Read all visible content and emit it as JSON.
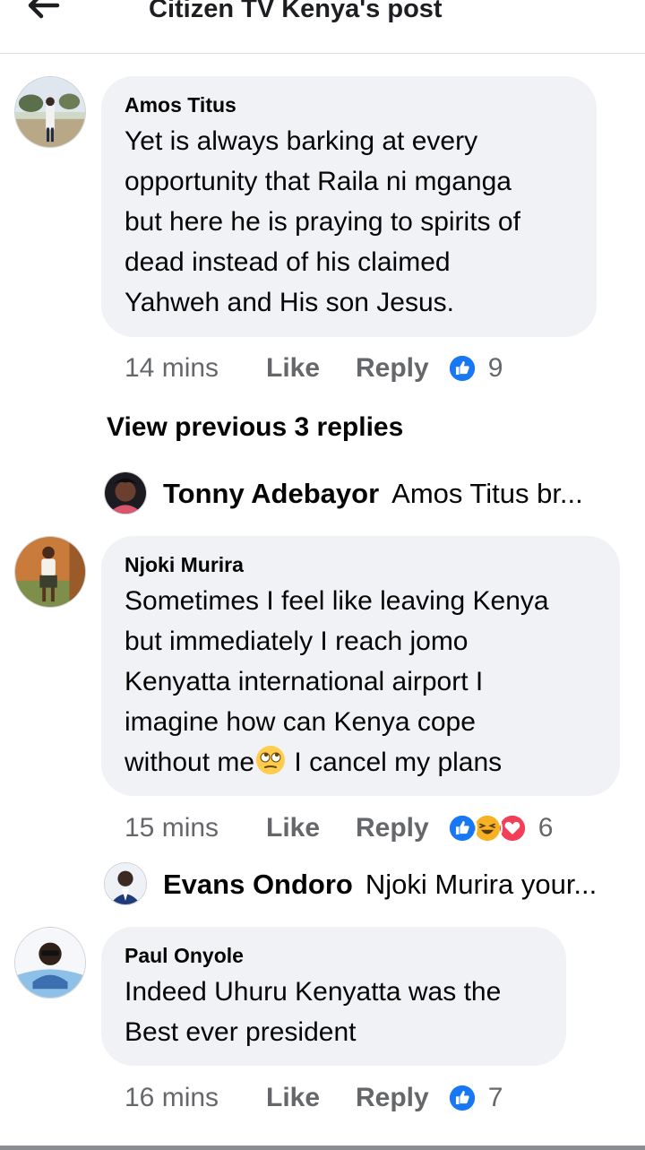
{
  "header": {
    "title": "Citizen TV Kenya's post"
  },
  "comments": [
    {
      "author": "Amos Titus",
      "text": "Yet is always barking at every\nopportunity that Raila ni mganga\nbut here he is praying to spirits of\ndead instead of his claimed\nYahweh and His son Jesus.",
      "time": "14 mins",
      "like_label": "Like",
      "reply_label": "Reply",
      "reactions": [
        "like-icon"
      ],
      "reaction_count": "9"
    },
    {
      "author": "Njoki Murira",
      "text_before_emoji": "Sometimes I feel like leaving Kenya\nbut immediately I reach jomo\nKenyatta international airport I\nimagine how can Kenya cope\nwithout me",
      "text_after_emoji": " I cancel my plans",
      "emoji": "eye-roll-emoji",
      "time": "15 mins",
      "like_label": "Like",
      "reply_label": "Reply",
      "reactions": [
        "like-icon",
        "haha-icon",
        "love-icon"
      ],
      "reaction_count": "6"
    },
    {
      "author": "Paul Onyole",
      "text": "Indeed Uhuru Kenyatta was the\nBest ever president",
      "time": "16 mins",
      "like_label": "Like",
      "reply_label": "Reply",
      "reactions": [
        "like-icon"
      ],
      "reaction_count": "7"
    }
  ],
  "view_previous_label": "View previous 3 replies",
  "replies": [
    {
      "author": "Tonny Adebayor",
      "snippet": "Amos Titus br..."
    },
    {
      "author": "Evans Ondoro",
      "snippet": "Njoki Murira your..."
    }
  ],
  "colors": {
    "like_blue": "#1877f2",
    "love_red": "#f33e58",
    "haha_yellow": "#f7b125",
    "bubble_bg": "#f0f2f5",
    "meta_gray": "#65676b"
  }
}
